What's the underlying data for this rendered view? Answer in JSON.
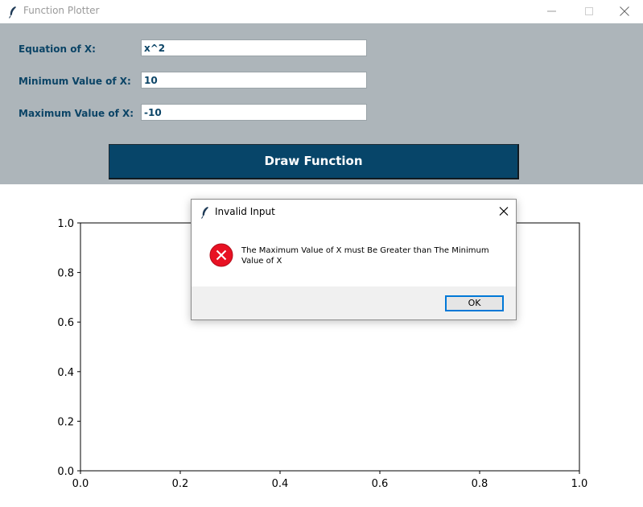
{
  "window": {
    "title": "Function Plotter",
    "app_icon": "feather-icon"
  },
  "form": {
    "equation_label": "Equation of X:",
    "equation_value": "x^2",
    "min_label": "Minimum Value of X:",
    "min_value": "10",
    "max_label": "Maximum Value of X:",
    "max_value": "-10",
    "draw_button": "Draw Function"
  },
  "colors": {
    "panel_bg": "#adb5ba",
    "label_text": "#0b4466",
    "button_bg": "#074569",
    "error_red": "#e81123"
  },
  "chart_data": {
    "type": "line",
    "series": [],
    "xlim": [
      0.0,
      1.0
    ],
    "ylim": [
      0.0,
      1.0
    ],
    "xticks": [
      "0.0",
      "0.2",
      "0.4",
      "0.6",
      "0.8",
      "1.0"
    ],
    "yticks": [
      "0.0",
      "0.2",
      "0.4",
      "0.6",
      "0.8",
      "1.0"
    ],
    "title": "",
    "xlabel": "",
    "ylabel": "",
    "grid": false
  },
  "dialog": {
    "title": "Invalid Input",
    "message": "The Maximum Value of X must Be Greater than The Minimum Value of X",
    "ok_button": "OK",
    "icon": "error-icon"
  }
}
